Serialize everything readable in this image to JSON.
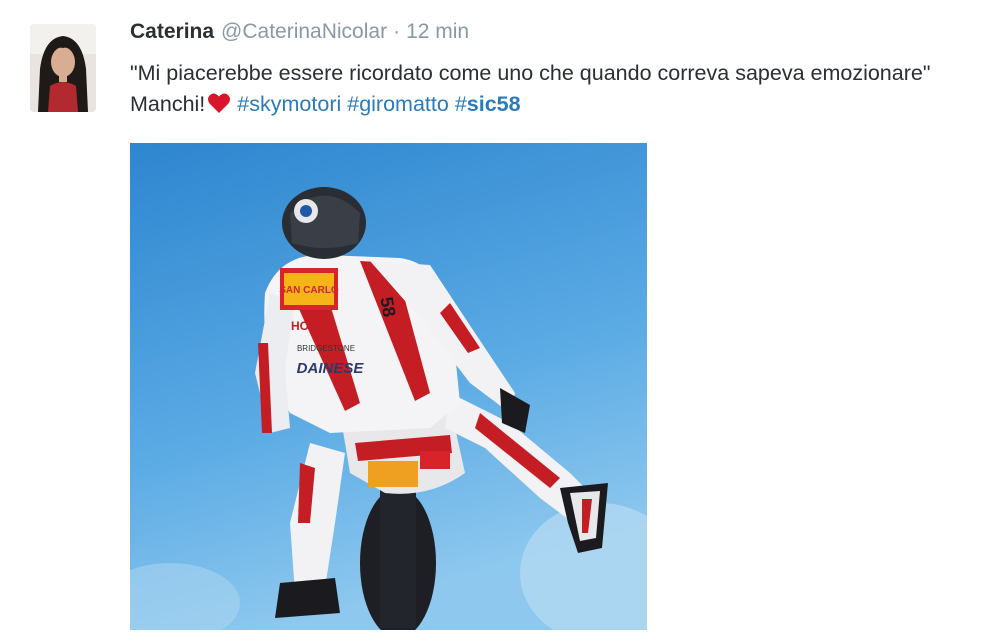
{
  "tweet": {
    "display_name": "Caterina",
    "handle": "@CaterinaNicolar",
    "separator": "·",
    "timestamp": "12 min",
    "text_part1": "\"Mi piacerebbe essere ricordato come uno che quando correva sapeva emozionare\" Manchi!",
    "heart_icon": "heart-emoji-icon",
    "hashtags": [
      {
        "hash": "#",
        "word": "skymotori"
      },
      {
        "hash": "#",
        "word": "giromatto"
      },
      {
        "hash": "#",
        "word": "sic58"
      }
    ],
    "media": {
      "description_icon": "photo-motorcycle-rider",
      "sponsor_texts": [
        "SAN CARLO",
        "HONDA",
        "BRIDGESTONE",
        "DAINESE",
        "58"
      ]
    }
  },
  "colors": {
    "text": "#292f33",
    "muted": "#8899a6",
    "link": "#2b7bb9",
    "heart": "#e0245e",
    "sky_top": "#2e86cf",
    "sky_bottom": "#8ec8ee"
  }
}
